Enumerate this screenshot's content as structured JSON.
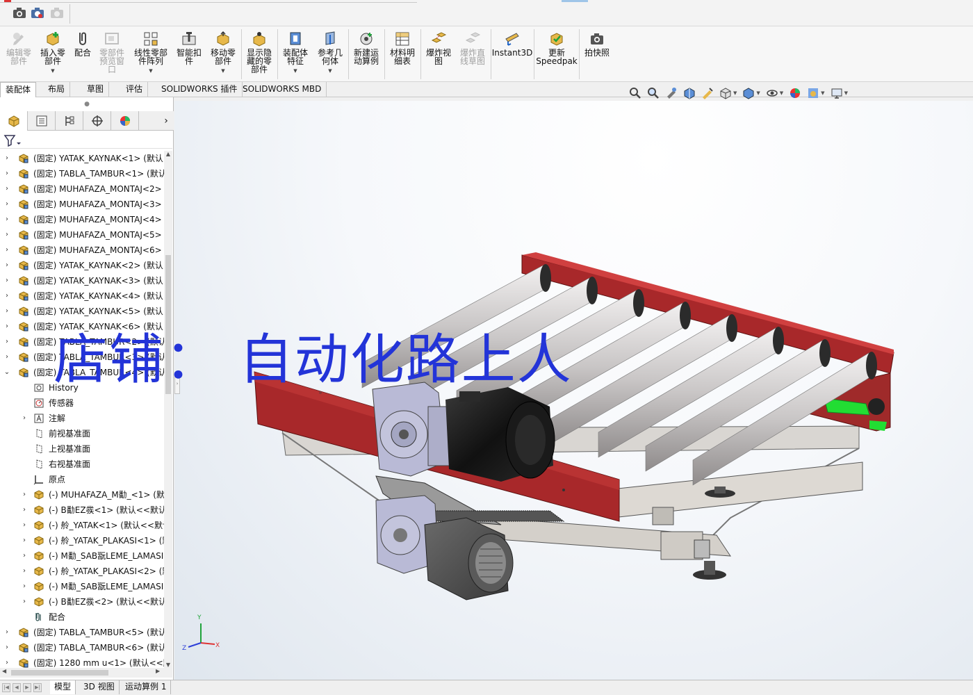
{
  "ribbon": {
    "buttons": [
      {
        "label": "编辑零\n部件",
        "icon": "edit-component-icon",
        "disabled": true,
        "dropdown": false
      },
      {
        "label": "插入零\n部件",
        "icon": "insert-components-icon",
        "disabled": false,
        "dropdown": true
      },
      {
        "label": "配合",
        "icon": "mate-icon",
        "disabled": false,
        "dropdown": false
      },
      {
        "label": "零部件\n预览窗\n口",
        "icon": "component-preview-icon",
        "disabled": true,
        "dropdown": false
      },
      {
        "label": "线性零部\n件阵列",
        "icon": "linear-pattern-icon",
        "disabled": false,
        "dropdown": true
      },
      {
        "label": "智能扣\n件",
        "icon": "smart-fasteners-icon",
        "disabled": false,
        "dropdown": false
      },
      {
        "label": "移动零\n部件",
        "icon": "move-component-icon",
        "disabled": false,
        "dropdown": true
      },
      {
        "label": "显示隐\n藏的零\n部件",
        "icon": "show-hidden-icon",
        "disabled": false,
        "dropdown": false
      },
      {
        "label": "装配体\n特征",
        "icon": "assembly-features-icon",
        "disabled": false,
        "dropdown": true
      },
      {
        "label": "参考几\n何体",
        "icon": "reference-geometry-icon",
        "disabled": false,
        "dropdown": true
      },
      {
        "label": "新建运\n动算例",
        "icon": "new-motion-study-icon",
        "disabled": false,
        "dropdown": false
      },
      {
        "label": "材料明\n细表",
        "icon": "bill-of-materials-icon",
        "disabled": false,
        "dropdown": false
      },
      {
        "label": "爆炸视\n图",
        "icon": "exploded-view-icon",
        "disabled": false,
        "dropdown": false
      },
      {
        "label": "爆炸直\n线草图",
        "icon": "explode-line-sketch-icon",
        "disabled": true,
        "dropdown": false
      },
      {
        "label": "Instant3D",
        "icon": "instant3d-icon",
        "disabled": false,
        "dropdown": false
      },
      {
        "label": "更新\nSpeedpak",
        "icon": "speedpak-icon",
        "disabled": false,
        "dropdown": false
      },
      {
        "label": "拍快照",
        "icon": "snapshot-icon",
        "disabled": false,
        "dropdown": false
      }
    ]
  },
  "command_tabs": [
    "装配体",
    "布局",
    "草图",
    "评估",
    "SOLIDWORKS 插件",
    "SOLIDWORKS MBD"
  ],
  "tree": {
    "items": [
      {
        "text": "(固定) YATAK_KAYNAK<1> (默认",
        "level": 0,
        "expand": "›",
        "icon": "subassembly"
      },
      {
        "text": "(固定) TABLA_TAMBUR<1> (默认",
        "level": 0,
        "expand": "›",
        "icon": "subassembly"
      },
      {
        "text": "(固定) MUHAFAZA_MONTAJ<2>",
        "level": 0,
        "expand": "›",
        "icon": "subassembly"
      },
      {
        "text": "(固定) MUHAFAZA_MONTAJ<3>",
        "level": 0,
        "expand": "›",
        "icon": "subassembly"
      },
      {
        "text": "(固定) MUHAFAZA_MONTAJ<4>",
        "level": 0,
        "expand": "›",
        "icon": "subassembly"
      },
      {
        "text": "(固定) MUHAFAZA_MONTAJ<5>",
        "level": 0,
        "expand": "›",
        "icon": "subassembly"
      },
      {
        "text": "(固定) MUHAFAZA_MONTAJ<6>",
        "level": 0,
        "expand": "›",
        "icon": "subassembly"
      },
      {
        "text": "(固定) YATAK_KAYNAK<2> (默认",
        "level": 0,
        "expand": "›",
        "icon": "subassembly"
      },
      {
        "text": "(固定) YATAK_KAYNAK<3> (默认",
        "level": 0,
        "expand": "›",
        "icon": "subassembly"
      },
      {
        "text": "(固定) YATAK_KAYNAK<4> (默认",
        "level": 0,
        "expand": "›",
        "icon": "subassembly"
      },
      {
        "text": "(固定) YATAK_KAYNAK<5> (默认",
        "level": 0,
        "expand": "›",
        "icon": "subassembly"
      },
      {
        "text": "(固定) YATAK_KAYNAK<6> (默认",
        "level": 0,
        "expand": "›",
        "icon": "subassembly"
      },
      {
        "text": "(固定) TABLA_TAMBUR<2> (默认",
        "level": 0,
        "expand": "›",
        "icon": "subassembly"
      },
      {
        "text": "(固定) TABLA_TAMBUR<3> (默认",
        "level": 0,
        "expand": "›",
        "icon": "subassembly"
      },
      {
        "text": "(固定) TABLA_TAMBUR<4> (默认",
        "level": 0,
        "expand": "⌄",
        "icon": "subassembly"
      },
      {
        "text": "History",
        "level": 1,
        "expand": "",
        "icon": "history"
      },
      {
        "text": "传感器",
        "level": 1,
        "expand": "",
        "icon": "sensor"
      },
      {
        "text": "注解",
        "level": 1,
        "expand": "›",
        "icon": "annotation"
      },
      {
        "text": "前视基准面",
        "level": 1,
        "expand": "",
        "icon": "plane"
      },
      {
        "text": "上视基准面",
        "level": 1,
        "expand": "",
        "icon": "plane"
      },
      {
        "text": "右视基准面",
        "level": 1,
        "expand": "",
        "icon": "plane"
      },
      {
        "text": "原点",
        "level": 1,
        "expand": "",
        "icon": "origin"
      },
      {
        "text": "(-) MUHAFAZA_M勫_<1> (默",
        "level": 1,
        "expand": "›",
        "icon": "part"
      },
      {
        "text": "(-) B勫EZ彂<1> (默认<<默认",
        "level": 1,
        "expand": "›",
        "icon": "part"
      },
      {
        "text": "(-) 舲_YATAK<1> (默认<<默认",
        "level": 1,
        "expand": "›",
        "icon": "part"
      },
      {
        "text": "(-) 舲_YATAK_PLAKASI<1> (默",
        "level": 1,
        "expand": "›",
        "icon": "part"
      },
      {
        "text": "(-) M勫_SAB翫LEME_LAMASI",
        "level": 1,
        "expand": "›",
        "icon": "part"
      },
      {
        "text": "(-) 舲_YATAK_PLAKASI<2> (默",
        "level": 1,
        "expand": "›",
        "icon": "part"
      },
      {
        "text": "(-) M勫_SAB翫LEME_LAMASI",
        "level": 1,
        "expand": "›",
        "icon": "part"
      },
      {
        "text": "(-) B勫EZ彂<2> (默认<<默认",
        "level": 1,
        "expand": "›",
        "icon": "part"
      },
      {
        "text": "配合",
        "level": 1,
        "expand": "",
        "icon": "mates"
      },
      {
        "text": "(固定) TABLA_TAMBUR<5> (默认",
        "level": 0,
        "expand": "›",
        "icon": "subassembly"
      },
      {
        "text": "(固定) TABLA_TAMBUR<6> (默认",
        "level": 0,
        "expand": "›",
        "icon": "subassembly"
      },
      {
        "text": "(固定) 1280 mm u<1> (默认<<默",
        "level": 0,
        "expand": "›",
        "icon": "subassembly"
      }
    ]
  },
  "viewport": {
    "watermark": "店铺： 自动化路上人",
    "triad": {
      "x": "X",
      "y": "Y",
      "z": "Z"
    }
  },
  "bottom_tabs": [
    "模型",
    "3D 视图",
    "运动算例 1"
  ],
  "colors": {
    "frame_red": "#a8282a",
    "roller_gray": "#c7c4c4",
    "watermark_blue": "#2334d8",
    "selection_green": "#22dd33"
  }
}
